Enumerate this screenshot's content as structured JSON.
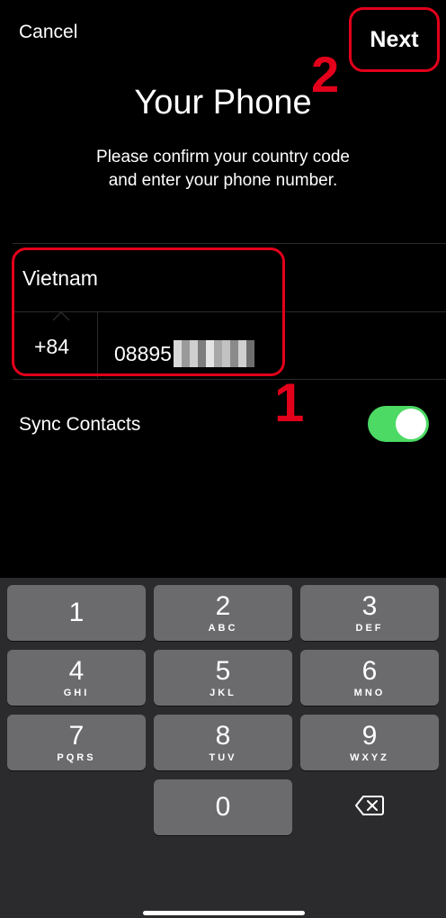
{
  "header": {
    "cancel_label": "Cancel",
    "next_label": "Next",
    "title": "Your Phone",
    "subtitle_line1": "Please confirm your country code",
    "subtitle_line2": "and enter your phone number."
  },
  "form": {
    "country": "Vietnam",
    "country_code": "+84",
    "phone_number": "08895",
    "sync_label": "Sync Contacts",
    "sync_enabled": true
  },
  "annotations": {
    "step1": "1",
    "step2": "2",
    "highlight_color": "#e3001b"
  },
  "colors": {
    "toggle_on": "#4cd964",
    "key_bg": "#6b6b6e",
    "keypad_bg": "#2b2b2d"
  },
  "keypad": {
    "keys": [
      {
        "digit": "1",
        "letters": ""
      },
      {
        "digit": "2",
        "letters": "ABC"
      },
      {
        "digit": "3",
        "letters": "DEF"
      },
      {
        "digit": "4",
        "letters": "GHI"
      },
      {
        "digit": "5",
        "letters": "JKL"
      },
      {
        "digit": "6",
        "letters": "MNO"
      },
      {
        "digit": "7",
        "letters": "PQRS"
      },
      {
        "digit": "8",
        "letters": "TUV"
      },
      {
        "digit": "9",
        "letters": "WXYZ"
      },
      {
        "digit": "0",
        "letters": ""
      }
    ],
    "backspace_icon": "backspace-icon"
  }
}
